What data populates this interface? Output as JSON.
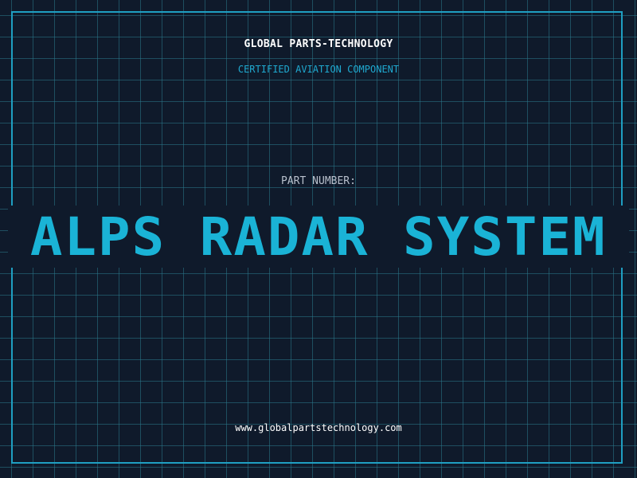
{
  "header": {
    "company": "GLOBAL PARTS-TECHNOLOGY",
    "subtitle": "CERTIFIED AVIATION COMPONENT"
  },
  "main": {
    "part_label": "PART NUMBER:",
    "part_title": "ALPS RADAR SYSTEM"
  },
  "footer": {
    "url": "www.globalpartstechnology.com"
  },
  "colors": {
    "background": "#0f1a2b",
    "grid": "#2a788c",
    "frame": "#1f9fc2",
    "accent": "#1ab3d6",
    "label": "#b8c0cc",
    "text": "#ffffff"
  }
}
